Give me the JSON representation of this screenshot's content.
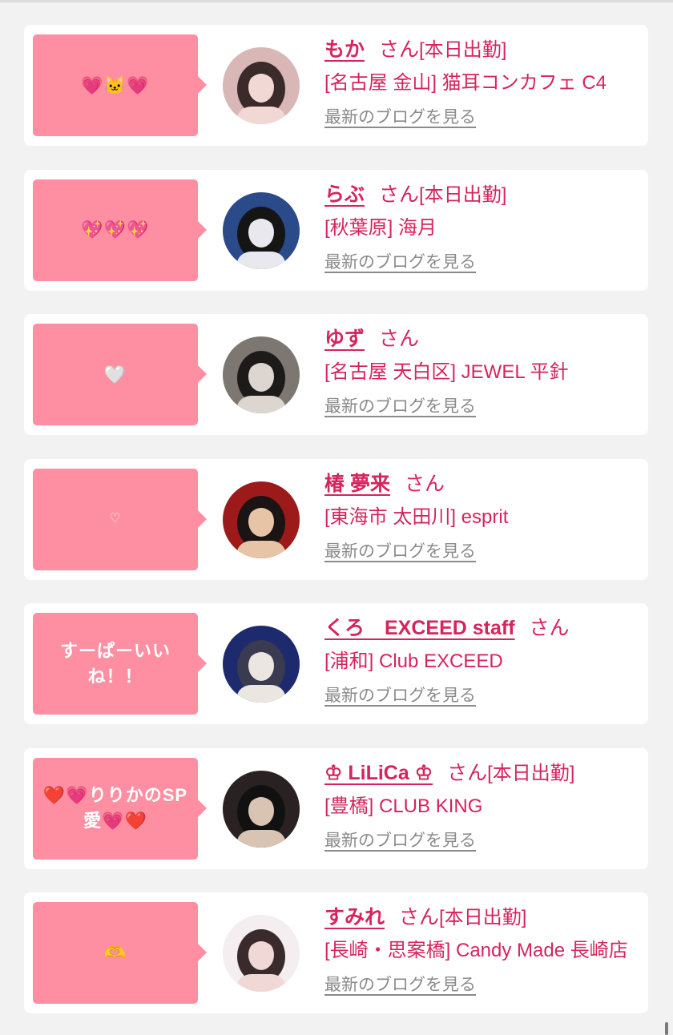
{
  "cards": [
    {
      "bubble_message": "💗🐱💗",
      "bubble_size": "normal",
      "name": "もか",
      "honorific": "さん",
      "status_tag": "[本日出勤]",
      "shop": "[名古屋 金山] 猫耳コンカフェ C4",
      "blog_link": "最新のブログを見る",
      "avatar_colors": [
        "#d8b7b6",
        "#3a2a2a",
        "#f2d8d5"
      ]
    },
    {
      "bubble_message": "💖💖💖",
      "bubble_size": "normal",
      "name": "らぶ",
      "honorific": "さん",
      "status_tag": "[本日出勤]",
      "shop": "[秋葉原] 海月",
      "blog_link": "最新のブログを見る",
      "avatar_colors": [
        "#2a4a8a",
        "#151515",
        "#e8e8ee"
      ]
    },
    {
      "bubble_message": "🤍",
      "bubble_size": "normal",
      "name": "ゆず",
      "honorific": "さん",
      "status_tag": "",
      "shop": "[名古屋 天白区] JEWEL 平針",
      "blog_link": "最新のブログを見る",
      "avatar_colors": [
        "#7d7771",
        "#1d1a1a",
        "#ddd5d0"
      ]
    },
    {
      "bubble_message": "♡",
      "bubble_size": "small",
      "name": "椿 夢来",
      "honorific": "さん",
      "status_tag": "",
      "shop": "[東海市 太田川] esprit",
      "blog_link": "最新のブログを見る",
      "avatar_colors": [
        "#9c1a1a",
        "#1b1414",
        "#e8c4a6"
      ]
    },
    {
      "bubble_message": "すーぱーいい\nね！！",
      "bubble_size": "normal",
      "name": "くろ　EXCEED staff",
      "honorific": "さん",
      "status_tag": "",
      "shop": "[浦和] Club EXCEED",
      "blog_link": "最新のブログを見る",
      "avatar_colors": [
        "#1d2a6e",
        "#3a3a50",
        "#ece6e0"
      ]
    },
    {
      "bubble_message": "❤️💗りりかのSP\n愛💗❤️",
      "bubble_size": "normal",
      "name": "♔ LiLiCa ♔",
      "honorific": "さん",
      "status_tag": "[本日出勤]",
      "shop": "[豊橋] CLUB KING",
      "blog_link": "最新のブログを見る",
      "avatar_colors": [
        "#2a2222",
        "#111111",
        "#d9c3b2"
      ]
    },
    {
      "bubble_message": "🫶",
      "bubble_size": "normal",
      "name": "すみれ",
      "honorific": "さん",
      "status_tag": "[本日出勤]",
      "shop": "[長崎・思案橋] Candy Made 長崎店",
      "blog_link": "最新のブログを見る",
      "avatar_colors": [
        "#f4eef0",
        "#3a2a2c",
        "#f0d8d6"
      ]
    }
  ]
}
